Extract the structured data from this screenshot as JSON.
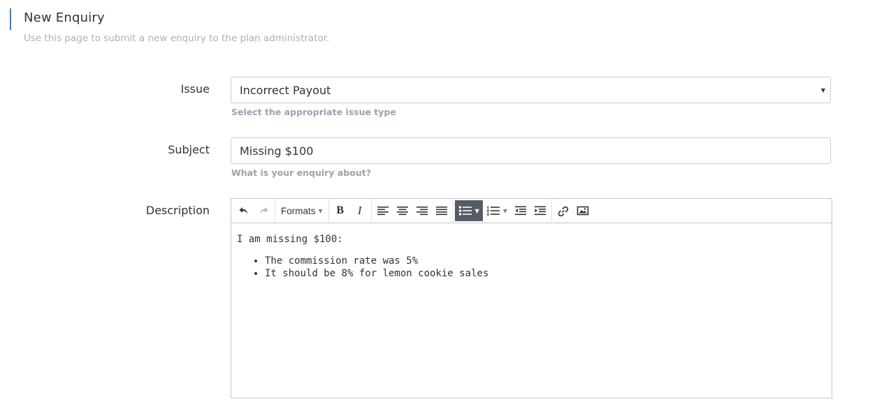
{
  "header": {
    "title": "New Enquiry",
    "subtitle": "Use this page to submit a new enquiry to the plan administrator."
  },
  "form": {
    "issue": {
      "label": "Issue",
      "selected": "Incorrect Payout",
      "help": "Select the appropriate issue type"
    },
    "subject": {
      "label": "Subject",
      "value": "Missing $100",
      "help": "What is your enquiry about?"
    },
    "description": {
      "label": "Description",
      "toolbar": {
        "formats_label": "Formats",
        "bold_label": "B",
        "italic_label": "I"
      },
      "content": {
        "intro": "I am missing $100:",
        "bullets": [
          "The commission rate was 5%",
          "It should be 8% for lemon cookie sales"
        ]
      }
    }
  },
  "colors": {
    "accent": "#3a7bd5",
    "active_button": "#555c66",
    "help_text": "#9aa3ad",
    "subtitle_text": "#aab0b6"
  }
}
